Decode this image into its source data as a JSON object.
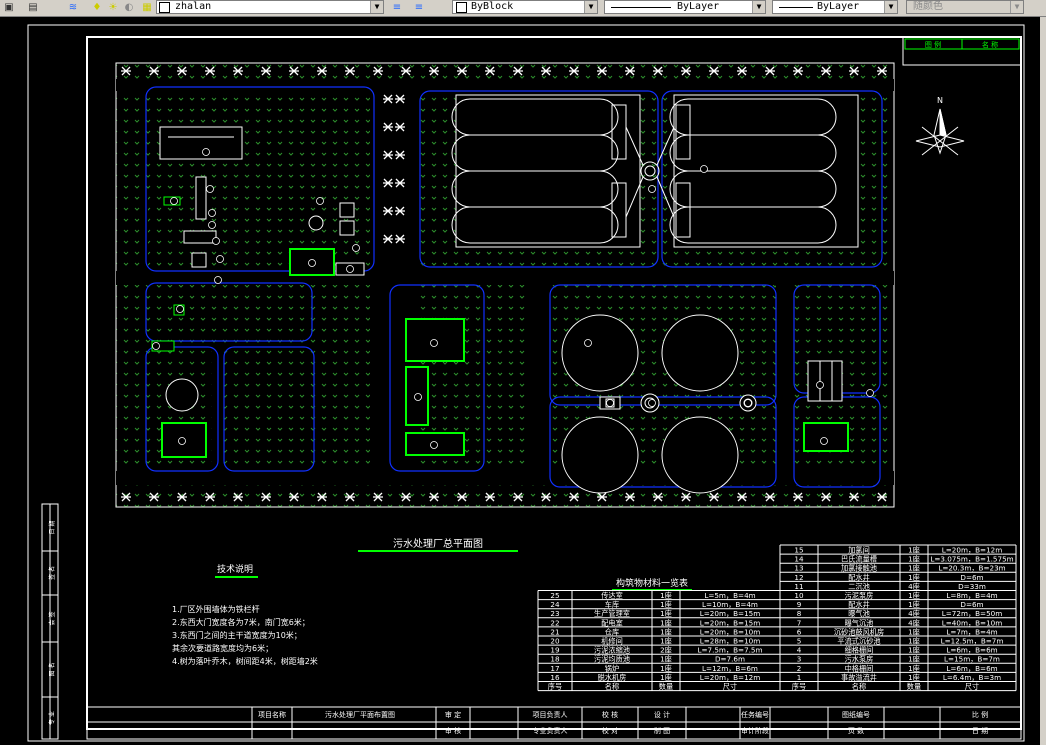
{
  "toolbar": {
    "layer_name": "zhalan",
    "color_combo": "ByBlock",
    "linetype_combo": "ByLayer",
    "lineweight_combo": "ByLayer",
    "plotstyle_combo": "随颜色"
  },
  "drawing": {
    "title": "污水处理厂总平面图",
    "notes_title": "技术说明",
    "notes": [
      "1.厂区外围墙体为铁栏杆",
      "2.东西大门宽度各为7米，南门宽6米；",
      "3.东西门之间的主干道宽度为10米；",
      "  其余次要道路宽度均为6米；",
      "4.树为落叶乔木，树间距4米，树距墙2米"
    ],
    "legend_box": [
      "图 例",
      "名 称"
    ],
    "table_title": "构筑物材料一览表",
    "table_left": [
      [
        "25",
        "传达室",
        "1座",
        "L=5m，B=4m"
      ],
      [
        "24",
        "车库",
        "1座",
        "L=10m，B=4m"
      ],
      [
        "23",
        "生产管理室",
        "1座",
        "L=20m，B=15m"
      ],
      [
        "22",
        "配电室",
        "1座",
        "L=20m，B=15m"
      ],
      [
        "21",
        "仓库",
        "1座",
        "L=20m，B=10m"
      ],
      [
        "20",
        "机修间",
        "1座",
        "L=28m，B=10m"
      ],
      [
        "19",
        "污泥浓缩池",
        "2座",
        "L=7.5m，B=7.5m"
      ],
      [
        "18",
        "污泥均质池",
        "1座",
        "D=7.6m"
      ],
      [
        "17",
        "锅炉",
        "1座",
        "L=12m，B=6m"
      ],
      [
        "16",
        "脱水机房",
        "1座",
        "L=20m，B=12m"
      ]
    ],
    "table_right": [
      [
        "15",
        "加氯间",
        "1座",
        "L=20m，B=12m"
      ],
      [
        "14",
        "巴氏流量槽",
        "1座",
        "L=3.075m，B=1.575m"
      ],
      [
        "13",
        "加氯接触池",
        "1座",
        "L=20.3m，B=23m"
      ],
      [
        "12",
        "配水井",
        "1座",
        "D=6m"
      ],
      [
        "11",
        "二沉池",
        "4座",
        "D=33m"
      ],
      [
        "10",
        "污泥泵房",
        "1座",
        "L=8m，B=4m"
      ],
      [
        "9",
        "配水井",
        "1座",
        "D=6m"
      ],
      [
        "8",
        "曝气池",
        "4座",
        "L=72m，B=50m"
      ],
      [
        "7",
        "曝气沉池",
        "4座",
        "L=40m，B=10m"
      ],
      [
        "6",
        "沉砂池鼓风机房",
        "1座",
        "L=7m，B=4m"
      ],
      [
        "5",
        "平流式沉砂池",
        "1座",
        "L=12.5m，B=7m"
      ],
      [
        "4",
        "细格栅间",
        "1座",
        "L=6m，B=6m"
      ],
      [
        "3",
        "污水泵房",
        "1座",
        "L=15m，B=7m"
      ],
      [
        "2",
        "中格栅间",
        "1座",
        "L=6m，B=6m"
      ],
      [
        "1",
        "事故溢流井",
        "1座",
        "L=6.4m，B=3m"
      ]
    ],
    "table_footer": [
      "序号",
      "名称",
      "数量",
      "尺寸",
      "序号",
      "名称",
      "数量",
      "尺寸"
    ],
    "title_block": {
      "project_name_label": "项目名称",
      "project_name": "污水处理厂平面布置图",
      "cells": [
        "审 定",
        "项目负责人",
        "校 核",
        "设 计",
        "任务编号",
        "图纸编号",
        "比 例",
        "审 核",
        "专业负责人",
        "校 对",
        "制 图",
        "审计阶段",
        "页 数",
        "日 期"
      ]
    },
    "side_strip": [
      "日 期",
      "签 名",
      "会 签",
      "图 名",
      "专 业"
    ],
    "north_label": "N"
  }
}
